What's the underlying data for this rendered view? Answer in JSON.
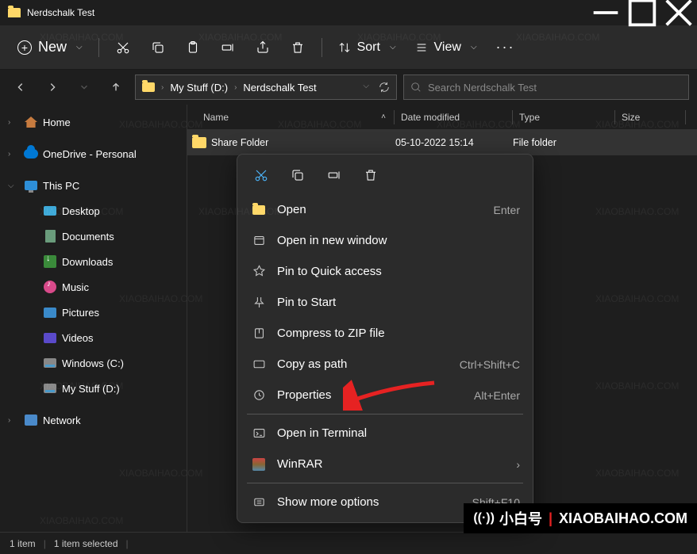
{
  "window": {
    "title": "Nerdschalk Test"
  },
  "toolbar": {
    "new_label": "New",
    "sort_label": "Sort",
    "view_label": "View"
  },
  "breadcrumb": {
    "seg1": "My Stuff (D:)",
    "seg2": "Nerdschalk Test"
  },
  "search": {
    "placeholder": "Search Nerdschalk Test"
  },
  "columns": {
    "name": "Name",
    "date": "Date modified",
    "type": "Type",
    "size": "Size"
  },
  "rows": [
    {
      "name": "Share Folder",
      "date": "05-10-2022 15:14",
      "type": "File folder",
      "size": ""
    }
  ],
  "nav": {
    "home": "Home",
    "onedrive": "OneDrive - Personal",
    "thispc": "This PC",
    "desktop": "Desktop",
    "documents": "Documents",
    "downloads": "Downloads",
    "music": "Music",
    "pictures": "Pictures",
    "videos": "Videos",
    "drive_c": "Windows (C:)",
    "drive_d": "My Stuff (D:)",
    "network": "Network"
  },
  "context_menu": {
    "open": {
      "label": "Open",
      "shortcut": "Enter"
    },
    "open_new": {
      "label": "Open in new window"
    },
    "pin_quick": {
      "label": "Pin to Quick access"
    },
    "pin_start": {
      "label": "Pin to Start"
    },
    "compress": {
      "label": "Compress to ZIP file"
    },
    "copy_path": {
      "label": "Copy as path",
      "shortcut": "Ctrl+Shift+C"
    },
    "properties": {
      "label": "Properties",
      "shortcut": "Alt+Enter"
    },
    "terminal": {
      "label": "Open in Terminal"
    },
    "winrar": {
      "label": "WinRAR"
    },
    "more": {
      "label": "Show more options",
      "shortcut": "Shift+F10"
    }
  },
  "status": {
    "count": "1 item",
    "selected": "1 item selected"
  },
  "watermark": {
    "text_cn": "小白号",
    "text_en": "XIAOBAIHAO.COM",
    "repeat": "XIAOBAIHAO.COM"
  }
}
